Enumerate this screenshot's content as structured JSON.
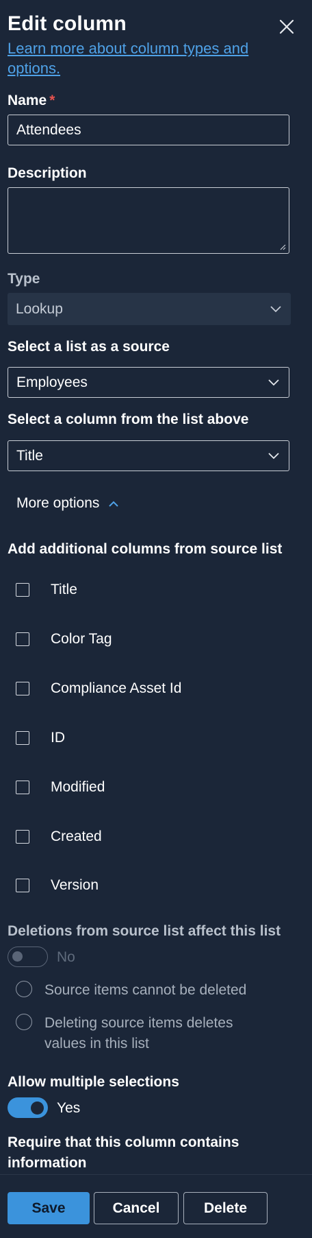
{
  "panel": {
    "title": "Edit column",
    "learn_more": "Learn more about column types and options."
  },
  "name_field": {
    "label": "Name",
    "required_mark": "*",
    "value": "Attendees"
  },
  "description_field": {
    "label": "Description",
    "value": ""
  },
  "type_field": {
    "label": "Type",
    "value": "Lookup"
  },
  "source_list": {
    "label": "Select a list as a source",
    "value": "Employees"
  },
  "source_column": {
    "label": "Select a column from the list above",
    "value": "Title"
  },
  "more_options": {
    "label": "More options"
  },
  "additional_columns": {
    "label": "Add additional columns from source list",
    "items": [
      "Title",
      "Color Tag",
      "Compliance Asset Id",
      "ID",
      "Modified",
      "Created",
      "Version"
    ]
  },
  "deletions": {
    "label": "Deletions from source list affect this list",
    "toggle_text": "No",
    "options": [
      "Source items cannot be deleted",
      "Deleting source items deletes values in this list"
    ]
  },
  "multiple": {
    "label": "Allow multiple selections",
    "toggle_text": "Yes"
  },
  "require": {
    "label": "Require that this column contains information"
  },
  "footer": {
    "save": "Save",
    "cancel": "Cancel",
    "delete": "Delete"
  },
  "colors": {
    "accent": "#3b93dc",
    "background": "#1b2638",
    "link": "#4fa2e8",
    "required": "#e8534f"
  }
}
